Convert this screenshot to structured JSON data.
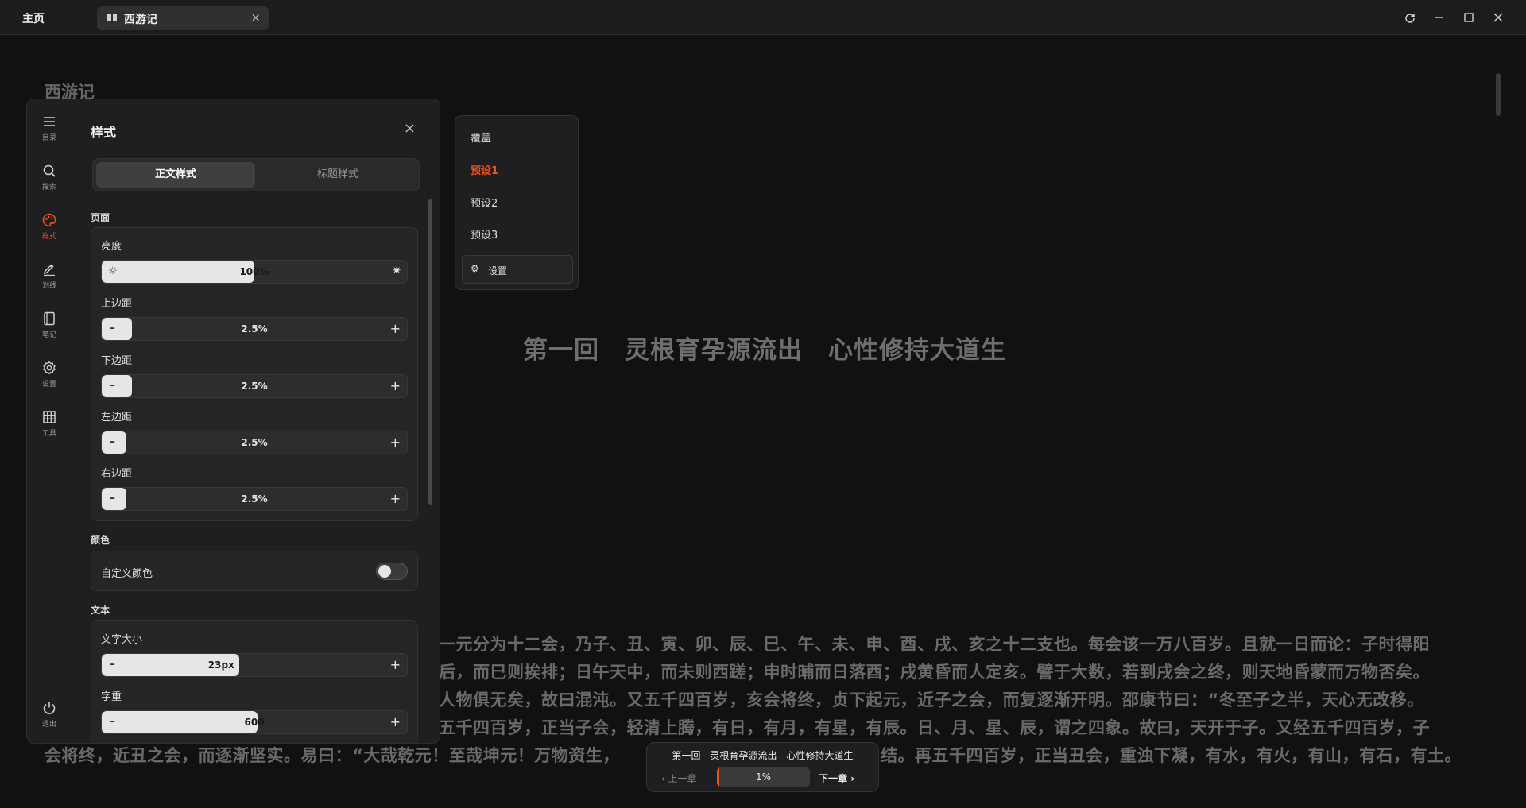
{
  "titlebar": {
    "home": "主页",
    "tab_label": "西游记",
    "tab_close": "×"
  },
  "reader": {
    "book_title": "西游记",
    "chapter_heading": "第一回　灵根育孕源流出　心性修持大道生",
    "lines": [
      "一元分为十二会，乃子、丑、寅、卯、辰、巳、午、未、申、酉、戌、亥之十二支也。每会该一万八百岁。且就一日而论：子时得阳",
      "后，而巳则挨排；日午天中，而未则西蹉；申时晡而日落酉；戌黄昏而人定亥。譬于大数，若到戌会之终，则天地昏蒙而万物否矣。",
      "人物俱无矣，故曰混沌。又五千四百岁，亥会将终，贞下起元，近子之会，而复逐渐开明。邵康节曰：“冬至子之半，天心无改移。",
      "五千四百岁，正当子会，轻清上腾，有日，有月，有星，有辰。日、月、星、辰，谓之四象。故曰，天开于子。又经五千四百岁，子",
      "会将终，近丑之会，而逐渐坚实。易曰：“大哉乾元！至哉坤元！万物资生，",
      "结。再五千四百岁，正当丑会，重浊下凝，有水，有火，有山，有石，有土。"
    ]
  },
  "rail": {
    "items": [
      {
        "label": "目录",
        "icon": "menu-icon"
      },
      {
        "label": "搜索",
        "icon": "search-icon"
      },
      {
        "label": "样式",
        "icon": "palette-icon"
      },
      {
        "label": "划线",
        "icon": "pen-icon"
      },
      {
        "label": "笔记",
        "icon": "notebook-icon"
      },
      {
        "label": "设置",
        "icon": "gear-icon"
      },
      {
        "label": "工具",
        "icon": "grid-icon"
      }
    ],
    "exit_label": "退出",
    "active_color": "#e8541e"
  },
  "panel": {
    "title": "样式",
    "close": "×",
    "tabs": [
      "正文样式",
      "标题样式"
    ],
    "sections": {
      "page": "页面",
      "color": "颜色",
      "text": "文本"
    },
    "brightness": {
      "label": "亮度",
      "value": "100%",
      "fraction": 0.5
    },
    "margin_top": {
      "label": "上边距",
      "value": "2.5%",
      "fraction": 0.1
    },
    "margin_bottom": {
      "label": "下边距",
      "value": "2.5%",
      "fraction": 0.1
    },
    "margin_left": {
      "label": "左边距",
      "value": "2.5%",
      "fraction": 0.08
    },
    "margin_right": {
      "label": "右边距",
      "value": "2.5%",
      "fraction": 0.08
    },
    "custom_color": {
      "label": "自定义颜色",
      "enabled": false
    },
    "font_size": {
      "label": "文字大小",
      "value": "23px",
      "fraction": 0.45
    },
    "font_weight": {
      "label": "字重",
      "value": "600",
      "fraction": 0.51
    },
    "minus": "–",
    "plus": "+"
  },
  "presets": {
    "items": [
      "覆盖",
      "预设1",
      "预设2",
      "预设3"
    ],
    "active": "预设1",
    "settings_label": "设置"
  },
  "bottom_nav": {
    "chapter": "第一回　灵根育孕源流出　心性修持大道生",
    "prev": "上一章",
    "next": "下一章",
    "progress_text": "1%",
    "progress": 0.01
  }
}
